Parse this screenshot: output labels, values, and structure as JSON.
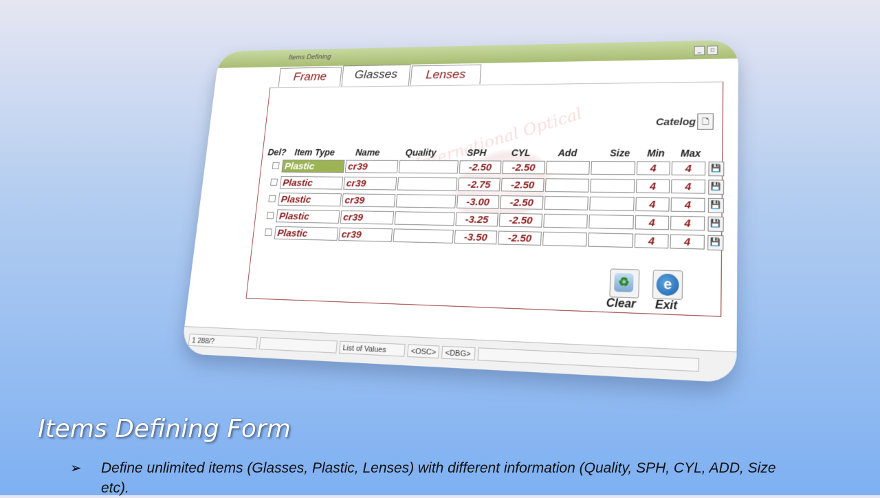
{
  "window": {
    "title": "Items Defining",
    "tabs": [
      {
        "label": "Frame"
      },
      {
        "label": "Glasses"
      },
      {
        "label": "Lenses"
      }
    ],
    "watermark": "International Optical",
    "catalog_label": "Catelog",
    "headers": {
      "del": "Del?",
      "item_type": "Item Type",
      "name": "Name",
      "quality": "Quality",
      "sph": "SPH",
      "cyl": "CYL",
      "add": "Add",
      "size": "Size",
      "min": "Min",
      "max": "Max"
    },
    "rows": [
      {
        "item_type": "Plastic",
        "name": "cr39",
        "quality": "",
        "sph": "-2.50",
        "cyl": "-2.50",
        "add": "",
        "size": "",
        "min": "4",
        "max": "4"
      },
      {
        "item_type": "Plastic",
        "name": "cr39",
        "quality": "",
        "sph": "-2.75",
        "cyl": "-2.50",
        "add": "",
        "size": "",
        "min": "4",
        "max": "4"
      },
      {
        "item_type": "Plastic",
        "name": "cr39",
        "quality": "",
        "sph": "-3.00",
        "cyl": "-2.50",
        "add": "",
        "size": "",
        "min": "4",
        "max": "4"
      },
      {
        "item_type": "Plastic",
        "name": "cr39",
        "quality": "",
        "sph": "-3.25",
        "cyl": "-2.50",
        "add": "",
        "size": "",
        "min": "4",
        "max": "4"
      },
      {
        "item_type": "Plastic",
        "name": "cr39",
        "quality": "",
        "sph": "-3.50",
        "cyl": "-2.50",
        "add": "",
        "size": "",
        "min": "4",
        "max": "4"
      }
    ],
    "clear_label": "Clear",
    "exit_label": "Exit",
    "status": {
      "record": "1 288/?",
      "lov": "List of Values",
      "osc": "<OSC>",
      "dbg": "<DBG>"
    }
  },
  "slide": {
    "title": "Items Defining Form",
    "bullet": "Define unlimited items (Glasses, Plastic, Lenses) with different information (Quality, SPH, CYL, ADD, Size etc)."
  }
}
